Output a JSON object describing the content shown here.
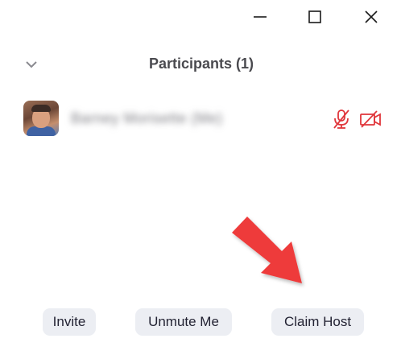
{
  "window_controls": {
    "minimize_icon": "minimize-icon",
    "maximize_icon": "maximize-icon",
    "close_icon": "close-icon"
  },
  "panel": {
    "title": "Participants (1)",
    "collapse_icon": "chevron-down-icon"
  },
  "participants": [
    {
      "name": "Barney Morisette (Me)",
      "name_blurred": true,
      "avatar": "participant-photo",
      "mic_status_icon": "muted-microphone-icon",
      "video_status_icon": "video-off-icon"
    }
  ],
  "footer": {
    "invite_label": "Invite",
    "unmute_label": "Unmute Me",
    "claim_host_label": "Claim Host"
  },
  "colors": {
    "muted_red": "#e0363b",
    "arrow_red": "#ee3b3b",
    "button_bg": "#eceef3",
    "title_text": "#4a4a4f",
    "button_text": "#232333"
  },
  "annotation": {
    "arrow_icon": "red-arrow-icon",
    "points_to": "claim-host-button"
  }
}
